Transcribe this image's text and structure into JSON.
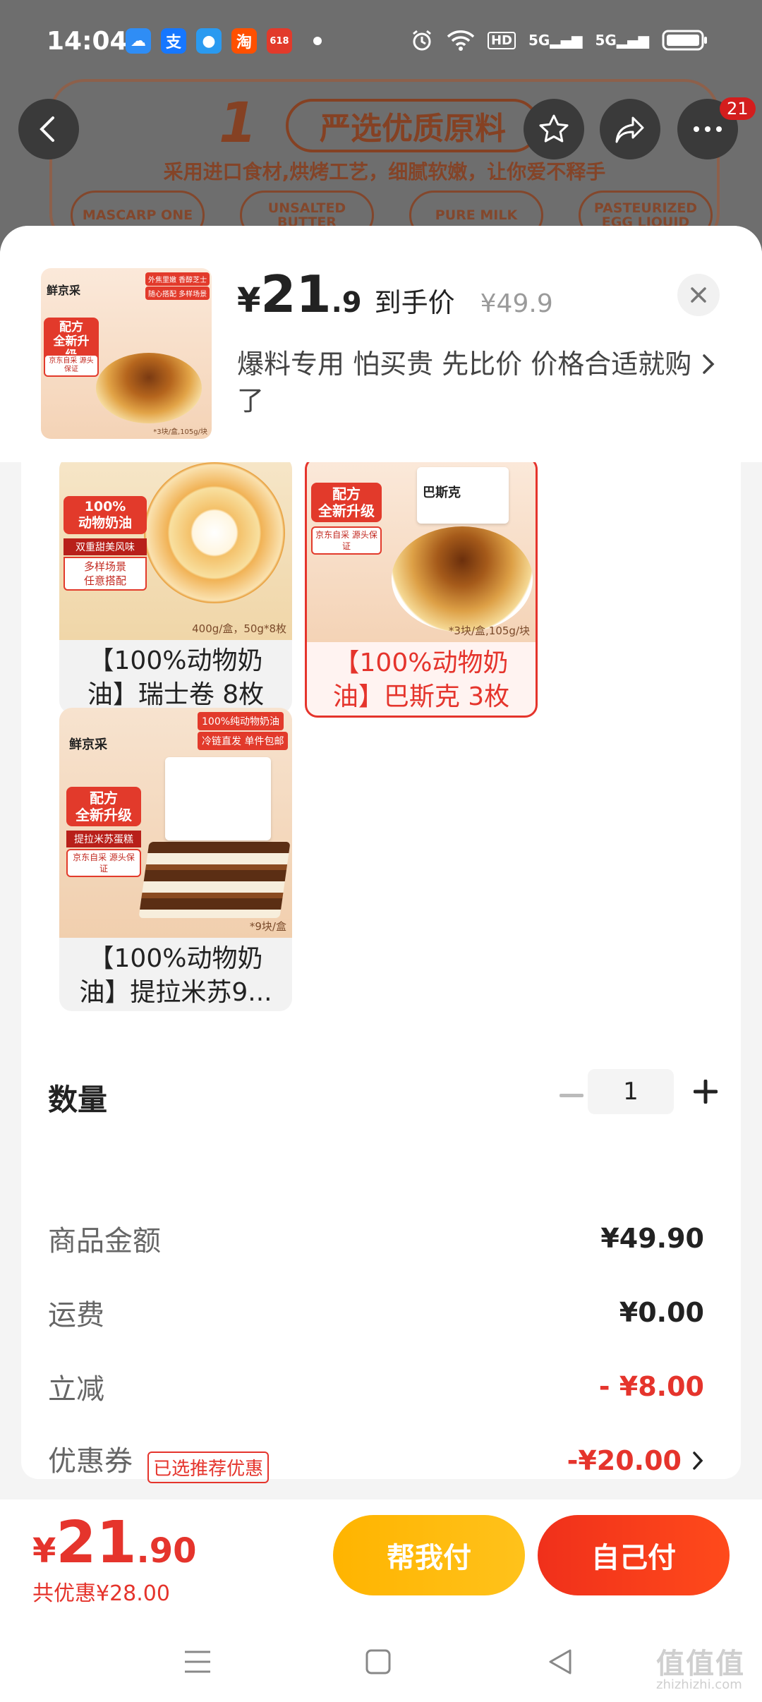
{
  "status_bar": {
    "time": "14:04",
    "apps": [
      {
        "icon": "cloud-weather-icon",
        "color": "#2f8df5"
      },
      {
        "icon": "alipay-icon",
        "label": "支",
        "color": "#1677ff"
      },
      {
        "icon": "qq-icon",
        "color": "#2a9af0"
      },
      {
        "icon": "taobao-icon",
        "label": "淘",
        "color": "#ff5000"
      },
      {
        "icon": "jd-618-icon",
        "label": "618",
        "color": "#e23a2b"
      }
    ],
    "signal_1": "5G",
    "signal_2": "5G",
    "hd_label": "HD"
  },
  "background_page": {
    "step_number": "1",
    "step_title": "严选优质原料",
    "subtitle": "采用进口食材,烘烤工艺，细腻软嫩，让你爱不释手",
    "tags": [
      "MASCARP ONE",
      "UNSALTED BUTTER",
      "PURE MILK",
      "PASTEURIZED EGG LIQUID"
    ],
    "notification_count": "21"
  },
  "header": {
    "currency": "¥",
    "price_int": "21",
    "price_dec": ".9",
    "price_label": "到手价",
    "original_price": "¥49.9",
    "description": "爆料专用 怕买贵 先比价 价格合适就购了",
    "thumb_brand": "鲜京采",
    "thumb_tag1": "外焦里嫩 香醇芝士",
    "thumb_tag2": "随心搭配 多样场景",
    "thumb_badge": "配方\n全新升级",
    "thumb_sub": "京东自采 源头保证",
    "thumb_pkg": "*3块/盒,105g/块"
  },
  "variants": [
    {
      "name": "【100%动物奶油】瑞士卷 8枚",
      "badge": "100%\n动物奶油",
      "sub": "双重甜美风味",
      "extra": "多样场景\n任意搭配",
      "pkg": "400g/盒，50g*8枚",
      "selected": false
    },
    {
      "name": "【100%动物奶油】巴斯克 3枚",
      "badge": "配方\n全新升级",
      "sub": "京东自采 源头保证",
      "box_label": "巴斯克",
      "pkg": "*3块/盒,105g/块",
      "selected": true
    },
    {
      "name": "【100%动物奶油】提拉米苏9...",
      "brand": "鲜京采",
      "badge": "配方\n全新升级",
      "sub": "提拉米苏蛋糕",
      "extra": "京东自采 源头保证",
      "top_tag": "100%纯动物奶油",
      "top_tag2": "冷链直发 单件包邮",
      "pkg": "*9块/盒",
      "selected": false
    }
  ],
  "quantity": {
    "label": "数量",
    "value": "1"
  },
  "summary": {
    "rows": [
      {
        "label": "商品金额",
        "value": "¥49.90"
      },
      {
        "label": "运费",
        "value": "¥0.00"
      },
      {
        "label": "立减",
        "value": "- ¥8.00"
      },
      {
        "label": "优惠券",
        "tag": "已选推荐优惠",
        "value": "-¥20.00"
      }
    ]
  },
  "bottom": {
    "currency": "¥",
    "total_int": "21",
    "total_dec": ".90",
    "saved": "共优惠¥28.00",
    "help_pay": "帮我付",
    "self_pay": "自己付"
  },
  "watermark": {
    "text": "值值值",
    "url": "zhizhizhi.com"
  },
  "colors": {
    "accent_red": "#e5342c",
    "help_yellow": "#ffb400",
    "self_red": "#f0301b"
  }
}
